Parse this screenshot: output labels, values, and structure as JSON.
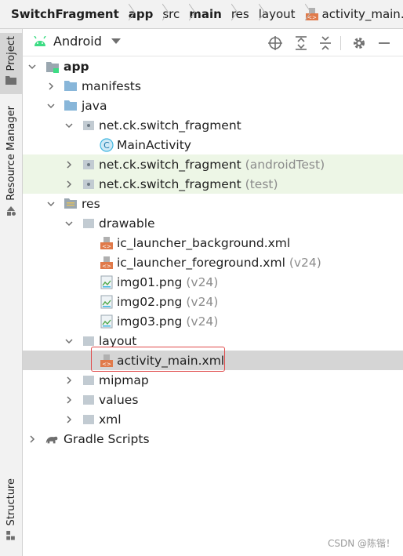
{
  "breadcrumb": [
    "SwitchFragment",
    "app",
    "src",
    "main",
    "res",
    "layout",
    "activity_main.xml"
  ],
  "left_strip": {
    "project": "Project",
    "resource_manager": "Resource Manager",
    "structure": "Structure"
  },
  "toolbar": {
    "view_mode": "Android"
  },
  "tree": {
    "app": "app",
    "manifests": "manifests",
    "java": "java",
    "pkg_main": "net.ck.switch_fragment",
    "main_activity": "MainActivity",
    "pkg_android_test": "net.ck.switch_fragment",
    "android_test_suffix": "(androidTest)",
    "pkg_test": "net.ck.switch_fragment",
    "test_suffix": "(test)",
    "res": "res",
    "drawable": "drawable",
    "ic_bg": "ic_launcher_background.xml",
    "ic_fg": "ic_launcher_foreground.xml",
    "ic_fg_suffix": "(v24)",
    "img01": "img01.png",
    "img01_suffix": "(v24)",
    "img02": "img02.png",
    "img02_suffix": "(v24)",
    "img03": "img03.png",
    "img03_suffix": "(v24)",
    "layout": "layout",
    "activity_main": "activity_main.xml",
    "mipmap": "mipmap",
    "values": "values",
    "xml": "xml",
    "gradle": "Gradle Scripts"
  },
  "colors": {
    "folder_blue": "#88b6d9",
    "folder_grey": "#9aa7b0",
    "class_blue": "#40b6e0",
    "xml_orange": "#e07a4a",
    "selection": "#d5d5d5",
    "test_bg": "#edf6e6",
    "highlight": "#e04a4a"
  },
  "watermark": "CSDN @陈锴！"
}
